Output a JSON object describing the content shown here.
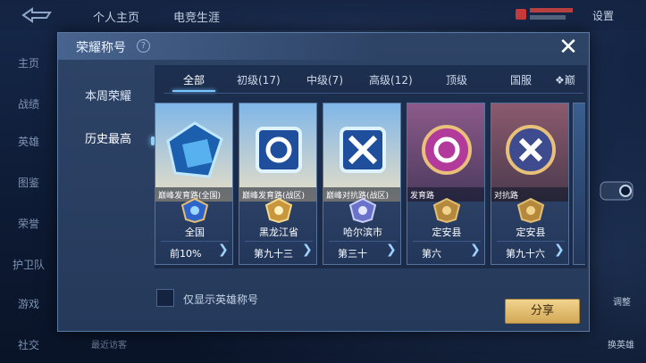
{
  "background": {
    "top_tabs": [
      "个人主页",
      "电竞生涯"
    ],
    "settings_label": "设置",
    "left_nav": [
      "主页",
      "战绩",
      "英雄",
      "图鉴",
      "荣誉",
      "护卫队",
      "游戏",
      "社交"
    ],
    "bottom_text": "最近访客",
    "right_labels": [
      "调整",
      "换英雄"
    ]
  },
  "modal": {
    "title": "荣耀称号",
    "help_symbol": "?",
    "close_symbol": "✕",
    "sidebar": [
      "本周荣耀",
      "历史最高"
    ],
    "active_sidebar": "历史最高",
    "tabs": [
      "全部",
      "初级(17)",
      "中级(7)",
      "高级(12)",
      "顶级",
      "国服",
      "❖巅"
    ],
    "active_tab": "全部",
    "cards": [
      {
        "title": "巅峰发育路(全国)",
        "place": "全国",
        "rank": "前10%",
        "art": "blue-cube"
      },
      {
        "title": "巅峰发育路(战区)",
        "place": "黑龙江省",
        "rank": "第九十三",
        "art": "blue-s"
      },
      {
        "title": "巅峰对抗路(战区)",
        "place": "哈尔滨市",
        "rank": "第三十",
        "art": "blue-x"
      },
      {
        "title": "发育路",
        "place": "定安县",
        "rank": "第六",
        "art": "pink-s"
      },
      {
        "title": "对抗路",
        "place": "定安县",
        "rank": "第九十六",
        "art": "pink-x"
      }
    ],
    "checkbox_label": "仅显示英雄称号",
    "share_label": "分享"
  },
  "colors": {
    "accent_blue": "#79c6ff",
    "gold": "#e3bf74",
    "panel": "#2e4467"
  }
}
